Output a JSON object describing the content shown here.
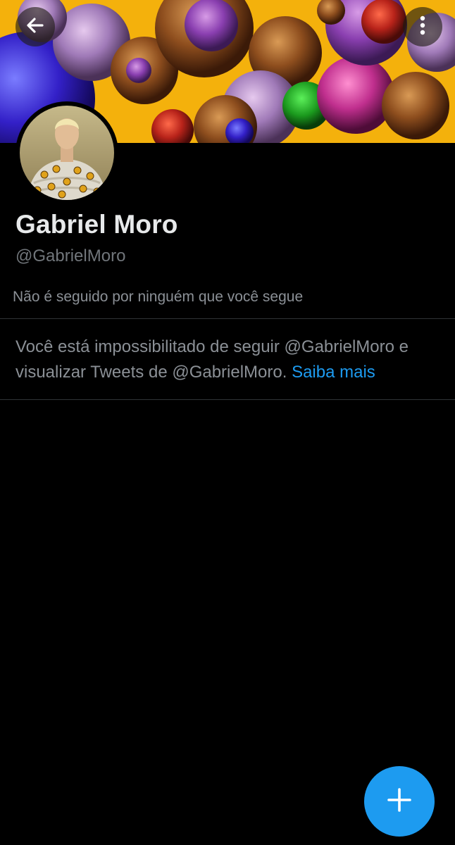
{
  "header": {
    "back_icon": "arrow-left-icon",
    "more_icon": "more-vertical-icon"
  },
  "profile": {
    "display_name": "Gabriel Moro",
    "handle": "@GabrielMoro",
    "followers_note": "Não é seguido por ninguém que você segue"
  },
  "blocked_notice": {
    "text": "Você está impossibilitado de seguir @GabrielMoro e visualizar Tweets de @GabrielMoro.",
    "link_label": "Saiba mais"
  },
  "fab": {
    "icon": "plus-icon"
  },
  "colors": {
    "background": "#000000",
    "accent": "#1d9bf0",
    "secondary_text": "#71767b",
    "divider": "#2f3336"
  }
}
